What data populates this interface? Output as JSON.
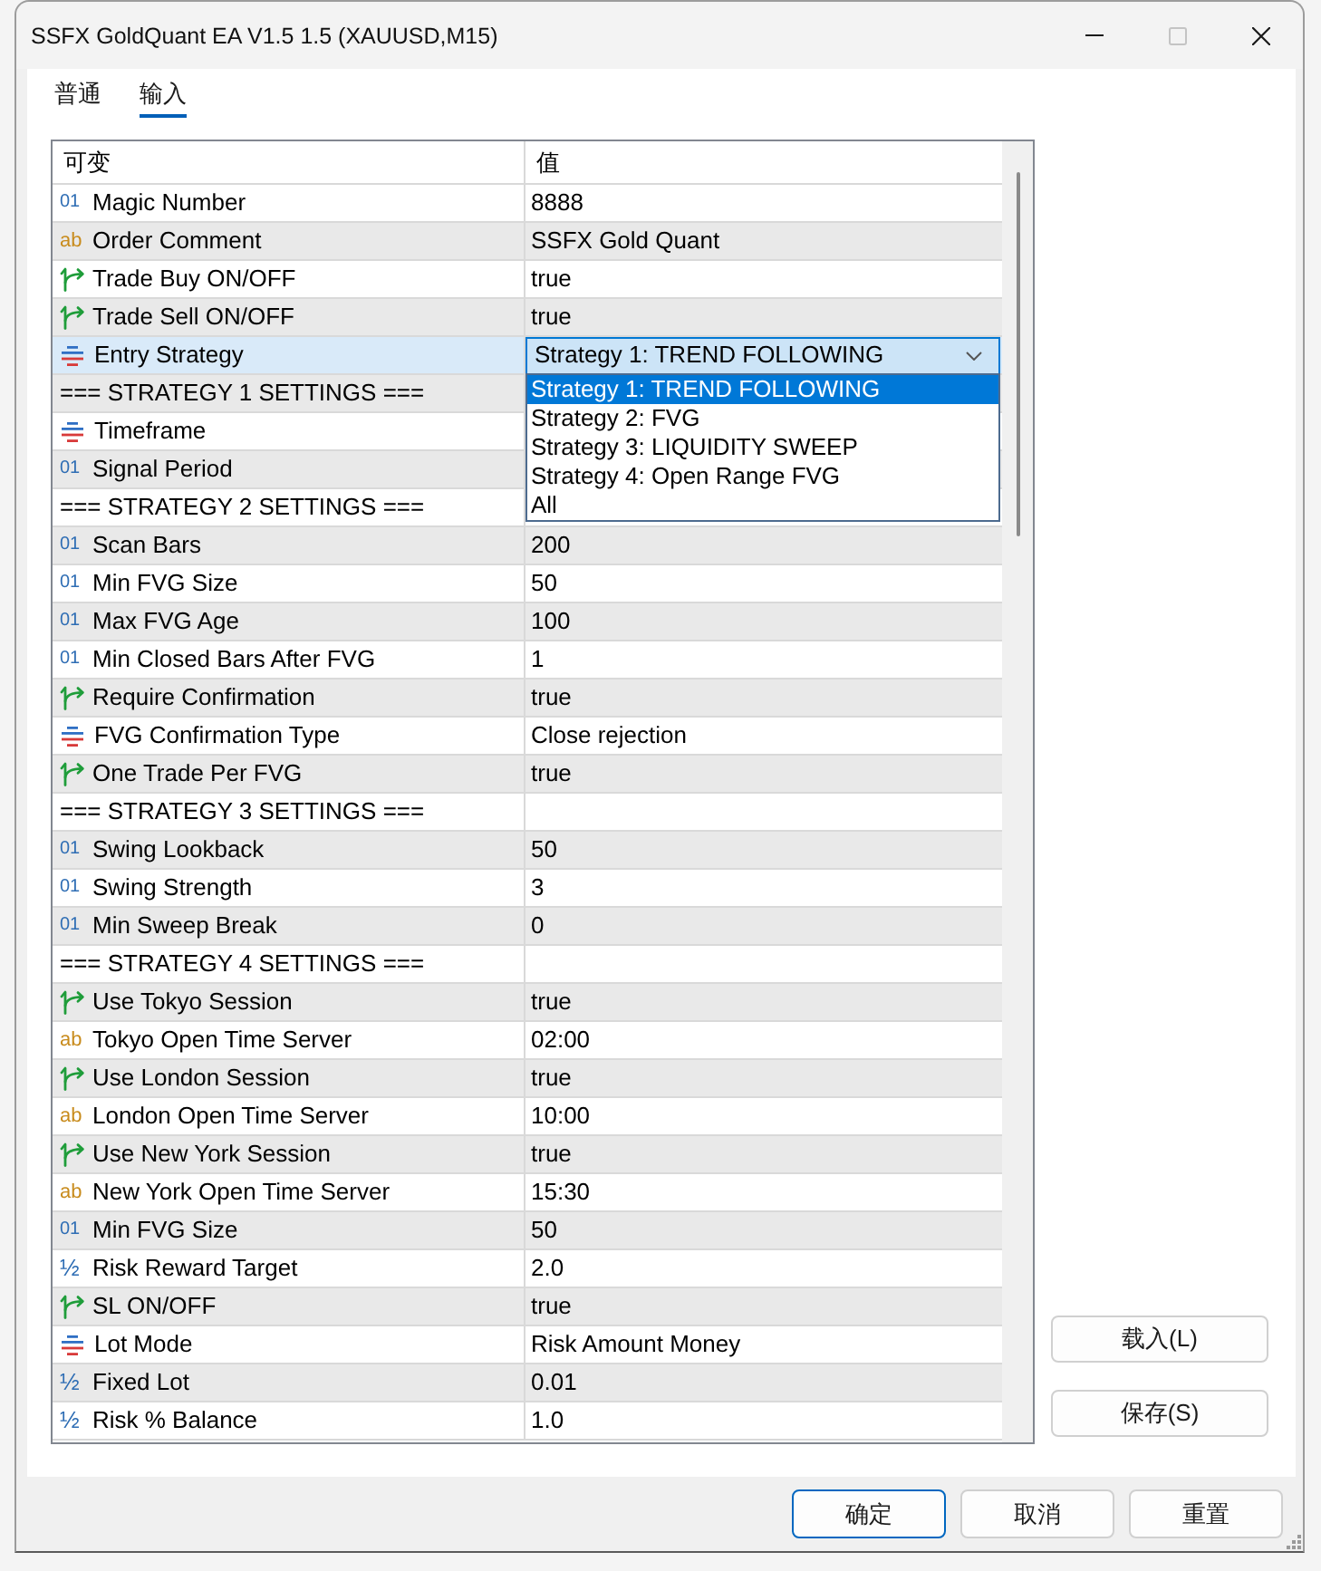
{
  "window": {
    "title": "SSFX GoldQuant EA V1.5 1.5 (XAUUSD,M15)",
    "controls": [
      {
        "kind": "minimize",
        "disabled": false
      },
      {
        "kind": "maximize",
        "disabled": true
      },
      {
        "kind": "close",
        "disabled": false
      }
    ]
  },
  "tabs": [
    {
      "label": "普通",
      "selected": false
    },
    {
      "label": "输入",
      "selected": true
    }
  ],
  "table": {
    "columns": [
      "可变",
      "值"
    ],
    "rows": [
      {
        "kind": "int",
        "type_label": "01",
        "name": "Magic Number",
        "value": "8888",
        "selected": false
      },
      {
        "kind": "string",
        "type_label": "ab",
        "name": "Order Comment",
        "value": "SSFX Gold Quant",
        "selected": false
      },
      {
        "kind": "bool",
        "name": "Trade Buy ON/OFF",
        "value": "true",
        "selected": false
      },
      {
        "kind": "bool",
        "name": "Trade Sell ON/OFF",
        "value": "true",
        "selected": false
      },
      {
        "kind": "enum",
        "name": "Entry Strategy",
        "selected": true,
        "dropdown": {
          "value": "Strategy 1: TREND FOLLOWING",
          "expanded": true,
          "options": [
            {
              "label": "Strategy 1: TREND FOLLOWING",
              "selected": true
            },
            {
              "label": "Strategy 2: FVG",
              "selected": false
            },
            {
              "label": "Strategy 3: LIQUIDITY SWEEP",
              "selected": false
            },
            {
              "label": "Strategy 4: Open Range FVG",
              "selected": false
            },
            {
              "label": "All",
              "selected": false
            }
          ]
        }
      },
      {
        "kind": "section",
        "name": "=== STRATEGY 1 SETTINGS ===",
        "selected": false
      },
      {
        "kind": "enum",
        "name": "Timeframe",
        "selected": false
      },
      {
        "kind": "int",
        "type_label": "01",
        "name": "Signal Period",
        "selected": false
      },
      {
        "kind": "section",
        "name": "=== STRATEGY 2 SETTINGS ===",
        "selected": false
      },
      {
        "kind": "int",
        "type_label": "01",
        "name": "Scan Bars",
        "value": "200",
        "selected": false
      },
      {
        "kind": "int",
        "type_label": "01",
        "name": "Min FVG Size",
        "value": "50",
        "selected": false
      },
      {
        "kind": "int",
        "type_label": "01",
        "name": "Max FVG Age",
        "value": "100",
        "selected": false
      },
      {
        "kind": "int",
        "type_label": "01",
        "name": "Min Closed Bars After FVG",
        "value": "1",
        "selected": false
      },
      {
        "kind": "bool",
        "name": "Require Confirmation",
        "value": "true",
        "selected": false
      },
      {
        "kind": "enum",
        "name": "FVG Confirmation Type",
        "value": "Close rejection",
        "selected": false
      },
      {
        "kind": "bool",
        "name": "One Trade Per FVG",
        "value": "true",
        "selected": false
      },
      {
        "kind": "section",
        "name": "=== STRATEGY 3 SETTINGS ===",
        "selected": false
      },
      {
        "kind": "int",
        "type_label": "01",
        "name": "Swing Lookback",
        "value": "50",
        "selected": false
      },
      {
        "kind": "int",
        "type_label": "01",
        "name": "Swing Strength",
        "value": "3",
        "selected": false
      },
      {
        "kind": "int",
        "type_label": "01",
        "name": "Min Sweep Break",
        "value": "0",
        "selected": false
      },
      {
        "kind": "section",
        "name": "=== STRATEGY 4 SETTINGS ===",
        "selected": false
      },
      {
        "kind": "bool",
        "name": "Use Tokyo Session",
        "value": "true",
        "selected": false
      },
      {
        "kind": "string",
        "type_label": "ab",
        "name": "Tokyo Open Time Server",
        "value": "02:00",
        "selected": false
      },
      {
        "kind": "bool",
        "name": "Use London Session",
        "value": "true",
        "selected": false
      },
      {
        "kind": "string",
        "type_label": "ab",
        "name": "London Open Time Server",
        "value": "10:00",
        "selected": false
      },
      {
        "kind": "bool",
        "name": "Use New York Session",
        "value": "true",
        "selected": false
      },
      {
        "kind": "string",
        "type_label": "ab",
        "name": "New York Open Time Server",
        "value": "15:30",
        "selected": false
      },
      {
        "kind": "int",
        "type_label": "01",
        "name": "Min FVG Size",
        "value": "50",
        "selected": false
      },
      {
        "kind": "double",
        "type_label": "½",
        "name": "Risk Reward Target",
        "value": "2.0",
        "selected": false
      },
      {
        "kind": "bool",
        "name": "SL ON/OFF",
        "value": "true",
        "selected": false
      },
      {
        "kind": "enum",
        "name": "Lot Mode",
        "value": "Risk Amount Money",
        "selected": false
      },
      {
        "kind": "double",
        "type_label": "½",
        "name": "Fixed Lot",
        "value": "0.01",
        "selected": false
      },
      {
        "kind": "double",
        "type_label": "½",
        "name": "Risk % Balance",
        "value": "1.0",
        "selected": false
      }
    ]
  },
  "side_buttons": [
    "载入(L)",
    "保存(S)"
  ],
  "buttons": [
    {
      "label": "确定",
      "default": true
    },
    {
      "label": "取消",
      "default": false
    },
    {
      "label": "重置",
      "default": false
    }
  ]
}
